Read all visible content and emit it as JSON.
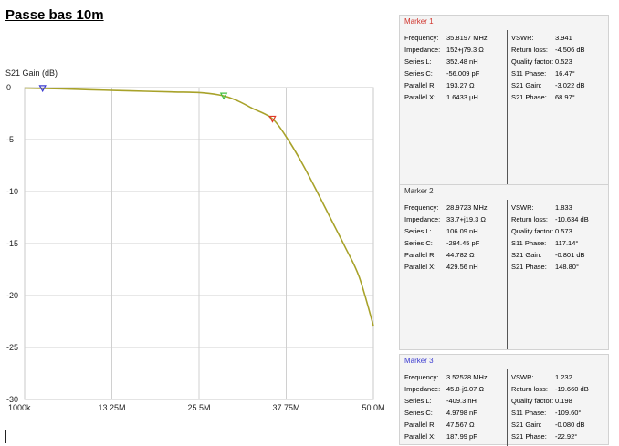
{
  "page": {
    "title": "Passe bas 10m"
  },
  "chart_data": {
    "type": "line",
    "ylabel": "S21 Gain (dB)",
    "x_tick_labels": [
      "1000k",
      "13.25M",
      "25.5M",
      "37.75M",
      "50.0M"
    ],
    "x_ticks_mhz": [
      1.0,
      13.25,
      25.5,
      37.75,
      50.0
    ],
    "xlim_mhz": [
      1.0,
      50.0
    ],
    "y_ticks": [
      0,
      -5,
      -10,
      -15,
      -20,
      -25,
      -30
    ],
    "ylim": [
      -30,
      0
    ],
    "grid": true,
    "series": [
      {
        "color": "#a8a22a",
        "x_mhz": [
          1.0,
          3.5,
          6,
          10,
          14,
          18,
          22,
          26,
          28.97,
          31,
          33,
          35.82,
          38,
          40,
          42,
          44,
          46,
          48,
          50
        ],
        "y_db": [
          -0.05,
          -0.08,
          -0.12,
          -0.2,
          -0.28,
          -0.35,
          -0.42,
          -0.5,
          -0.8,
          -1.3,
          -2.0,
          -3.0,
          -5.0,
          -7.3,
          -9.9,
          -12.6,
          -15.3,
          -18.2,
          -22.9
        ]
      }
    ],
    "markers": [
      {
        "id": 1,
        "x_mhz": 35.82,
        "y_db": -3.022,
        "color": "#e03a2a"
      },
      {
        "id": 2,
        "x_mhz": 28.97,
        "y_db": -0.801,
        "color": "#3fbf3f"
      },
      {
        "id": 3,
        "x_mhz": 3.525,
        "y_db": -0.08,
        "color": "#3b3bd0"
      }
    ]
  },
  "markers": [
    {
      "title": "Marker 1",
      "title_color": "#d0342c",
      "left": [
        {
          "label": "Frequency:",
          "value": "35.8197 MHz"
        },
        {
          "label": "Impedance:",
          "value": "152+j79.3 Ω"
        },
        {
          "label": "Series L:",
          "value": "352.48 nH"
        },
        {
          "label": "Series C:",
          "value": "-56.009 pF"
        },
        {
          "label": "Parallel R:",
          "value": "193.27 Ω"
        },
        {
          "label": "Parallel X:",
          "value": "1.6433 µH"
        }
      ],
      "right": [
        {
          "label": "VSWR:",
          "value": "3.941"
        },
        {
          "label": "Return loss:",
          "value": "-4.506 dB"
        },
        {
          "label": "Quality factor:",
          "value": "0.523"
        },
        {
          "label": "S11 Phase:",
          "value": "16.47°"
        },
        {
          "label": "S21 Gain:",
          "value": "-3.022 dB"
        },
        {
          "label": "S21 Phase:",
          "value": "68.97°"
        }
      ]
    },
    {
      "title": "Marker 2",
      "title_color": "#333333",
      "left": [
        {
          "label": "Frequency:",
          "value": "28.9723 MHz"
        },
        {
          "label": "Impedance:",
          "value": "33.7+j19.3 Ω"
        },
        {
          "label": "Series L:",
          "value": "106.09 nH"
        },
        {
          "label": "Series C:",
          "value": "-284.45 pF"
        },
        {
          "label": "Parallel R:",
          "value": "44.782 Ω"
        },
        {
          "label": "Parallel X:",
          "value": "429.56 nH"
        }
      ],
      "right": [
        {
          "label": "VSWR:",
          "value": "1.833"
        },
        {
          "label": "Return loss:",
          "value": "-10.634 dB"
        },
        {
          "label": "Quality factor:",
          "value": "0.573"
        },
        {
          "label": "S11 Phase:",
          "value": "117.14°"
        },
        {
          "label": "S21 Gain:",
          "value": "-0.801 dB"
        },
        {
          "label": "S21 Phase:",
          "value": "148.80°"
        }
      ]
    },
    {
      "title": "Marker 3",
      "title_color": "#3b3bd0",
      "left": [
        {
          "label": "Frequency:",
          "value": "3.52528 MHz"
        },
        {
          "label": "Impedance:",
          "value": "45.8-j9.07 Ω"
        },
        {
          "label": "Series L:",
          "value": "-409.3 nH"
        },
        {
          "label": "Series C:",
          "value": "4.9798 nF"
        },
        {
          "label": "Parallel R:",
          "value": "47.567 Ω"
        },
        {
          "label": "Parallel X:",
          "value": "187.99 pF"
        }
      ],
      "right": [
        {
          "label": "VSWR:",
          "value": "1.232"
        },
        {
          "label": "Return loss:",
          "value": "-19.660 dB"
        },
        {
          "label": "Quality factor:",
          "value": "0.198"
        },
        {
          "label": "S11 Phase:",
          "value": "-109.60°"
        },
        {
          "label": "S21 Gain:",
          "value": "-0.080 dB"
        },
        {
          "label": "S21 Phase:",
          "value": "-22.92°"
        }
      ]
    }
  ]
}
